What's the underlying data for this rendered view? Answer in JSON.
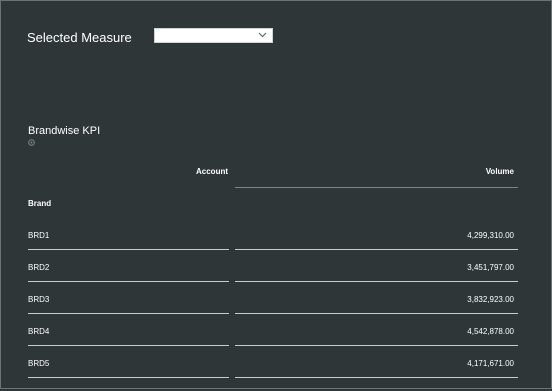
{
  "filter": {
    "label": "Selected Measure",
    "selected_value": ""
  },
  "widget": {
    "title": "Brandwise KPI"
  },
  "table": {
    "columns": {
      "account": "Account",
      "volume": "Volume"
    },
    "group_label": "Brand",
    "rows": [
      {
        "brand": "BRD1",
        "volume": "4,299,310.00"
      },
      {
        "brand": "BRD2",
        "volume": "3,451,797.00"
      },
      {
        "brand": "BRD3",
        "volume": "3,832,923.00"
      },
      {
        "brand": "BRD4",
        "volume": "4,542,878.00"
      },
      {
        "brand": "BRD5",
        "volume": "4,171,671.00"
      }
    ]
  },
  "icons": {
    "dropdown": "chevron-down-icon",
    "widget_info": "info-icon"
  }
}
